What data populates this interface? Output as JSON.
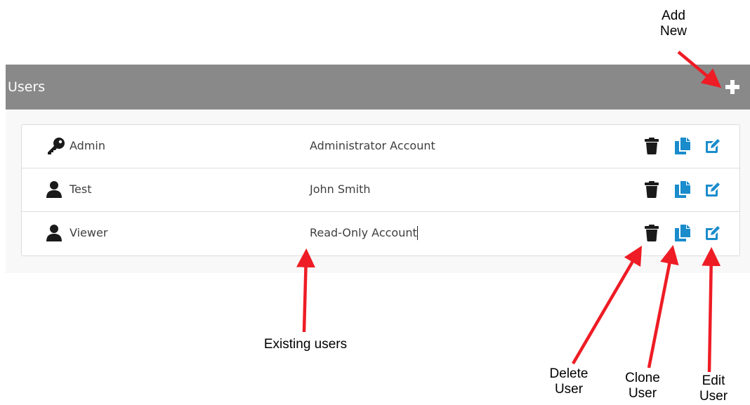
{
  "panel": {
    "title": "Users",
    "add_icon": "plus-icon"
  },
  "users": [
    {
      "name": "Admin",
      "description": "Administrator Account",
      "icon": "key-icon"
    },
    {
      "name": "Test",
      "description": "John Smith",
      "icon": "user-icon"
    },
    {
      "name": "Viewer",
      "description": "Read-Only Account",
      "icon": "user-icon"
    }
  ],
  "row_actions": {
    "delete_icon": "trash-icon",
    "clone_icon": "copy-icon",
    "edit_icon": "edit-icon"
  },
  "callouts": {
    "add_new_line1": "Add",
    "add_new_line2": "New",
    "existing_users": "Existing users",
    "delete_line1": "Delete",
    "delete_line2": "User",
    "clone_line1": "Clone",
    "clone_line2": "User",
    "edit_line1": "Edit",
    "edit_line2": "User"
  },
  "colors": {
    "header_bg": "#898989",
    "action_blue": "#1a8ccc",
    "icon_dark": "#1a1a1a",
    "callout_red": "#ee1c25"
  }
}
